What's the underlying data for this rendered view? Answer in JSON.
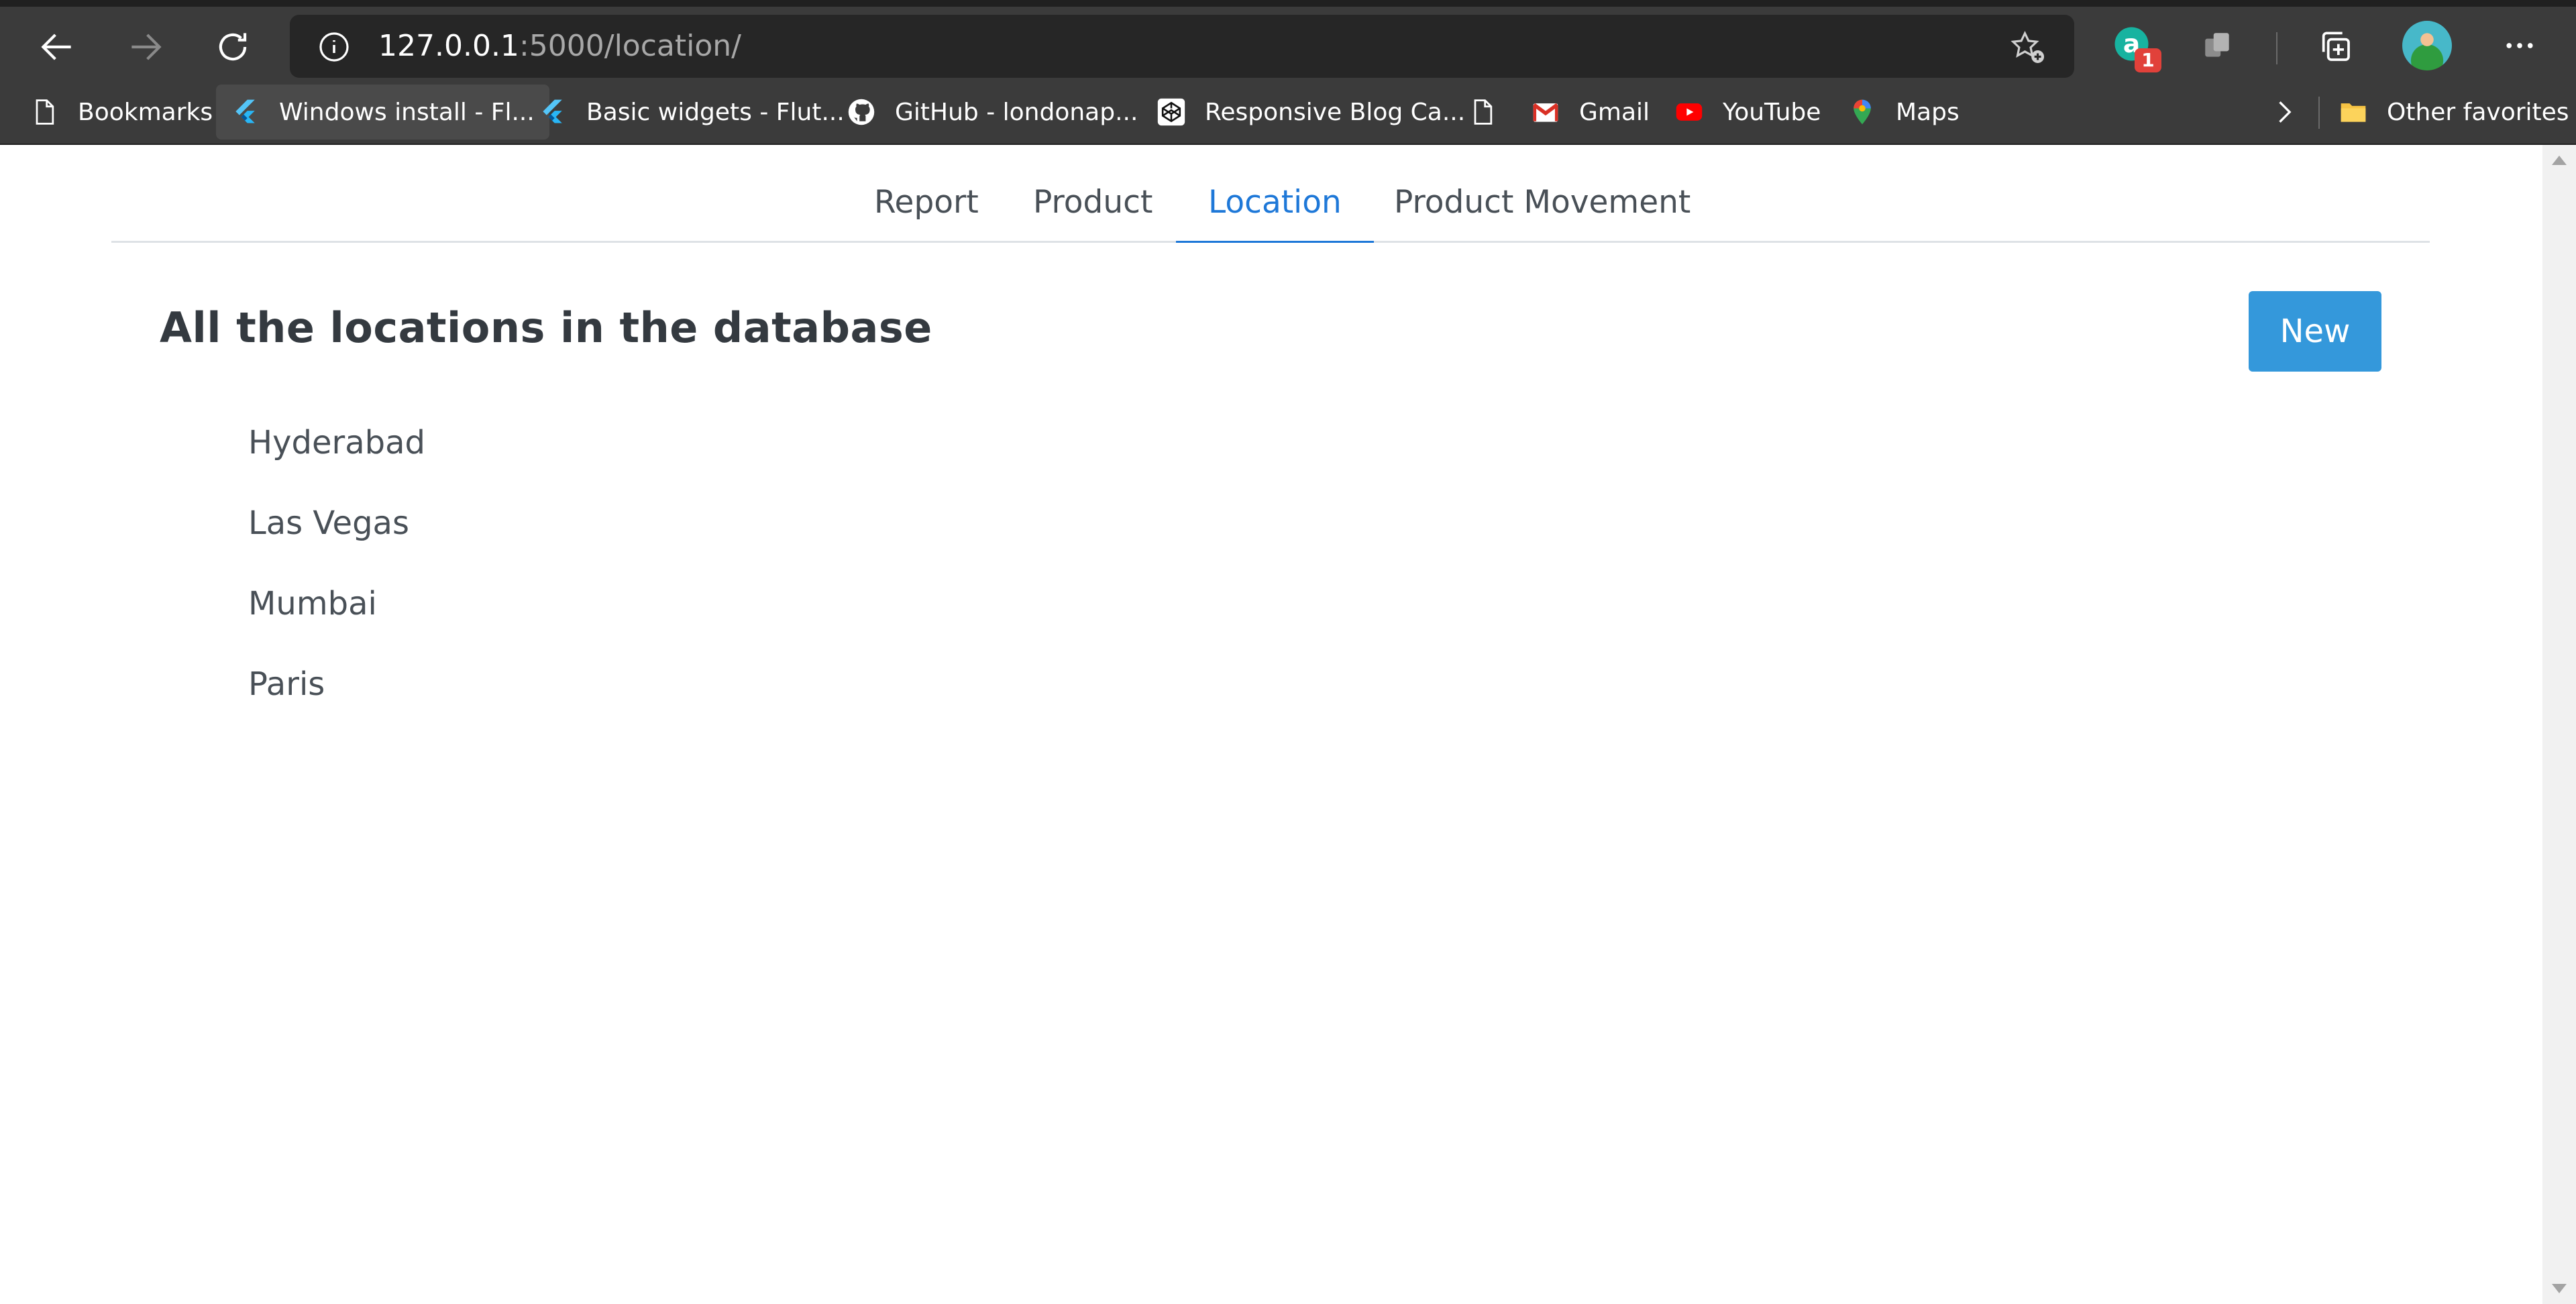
{
  "browser": {
    "url_host": "127.0.0.1",
    "url_path": ":5000/location/",
    "extension_badge": "1",
    "bookmarks": [
      {
        "label": "Bookmarks",
        "icon": "page-icon"
      },
      {
        "label": "Windows install - Fl...",
        "icon": "flutter-icon",
        "active": true
      },
      {
        "label": "Basic widgets - Flut...",
        "icon": "flutter-icon"
      },
      {
        "label": "GitHub - londonap...",
        "icon": "github-icon"
      },
      {
        "label": "Responsive Blog Ca...",
        "icon": "codepen-icon"
      },
      {
        "label": "",
        "icon": "page-icon"
      },
      {
        "label": "Gmail",
        "icon": "gmail-icon"
      },
      {
        "label": "YouTube",
        "icon": "youtube-icon"
      },
      {
        "label": "Maps",
        "icon": "maps-pin-icon"
      }
    ],
    "other_favorites": "Other favorites"
  },
  "nav": {
    "tabs": [
      "Report",
      "Product",
      "Location",
      "Product Movement"
    ],
    "active_tab": "Location"
  },
  "page": {
    "heading": "All the locations in the database",
    "new_button": "New",
    "locations": [
      "Hyderabad",
      "Las Vegas",
      "Mumbai",
      "Paris"
    ]
  },
  "colors": {
    "accent": "#1e78d8",
    "button": "#3498db",
    "chrome": "#3b3b3b"
  }
}
